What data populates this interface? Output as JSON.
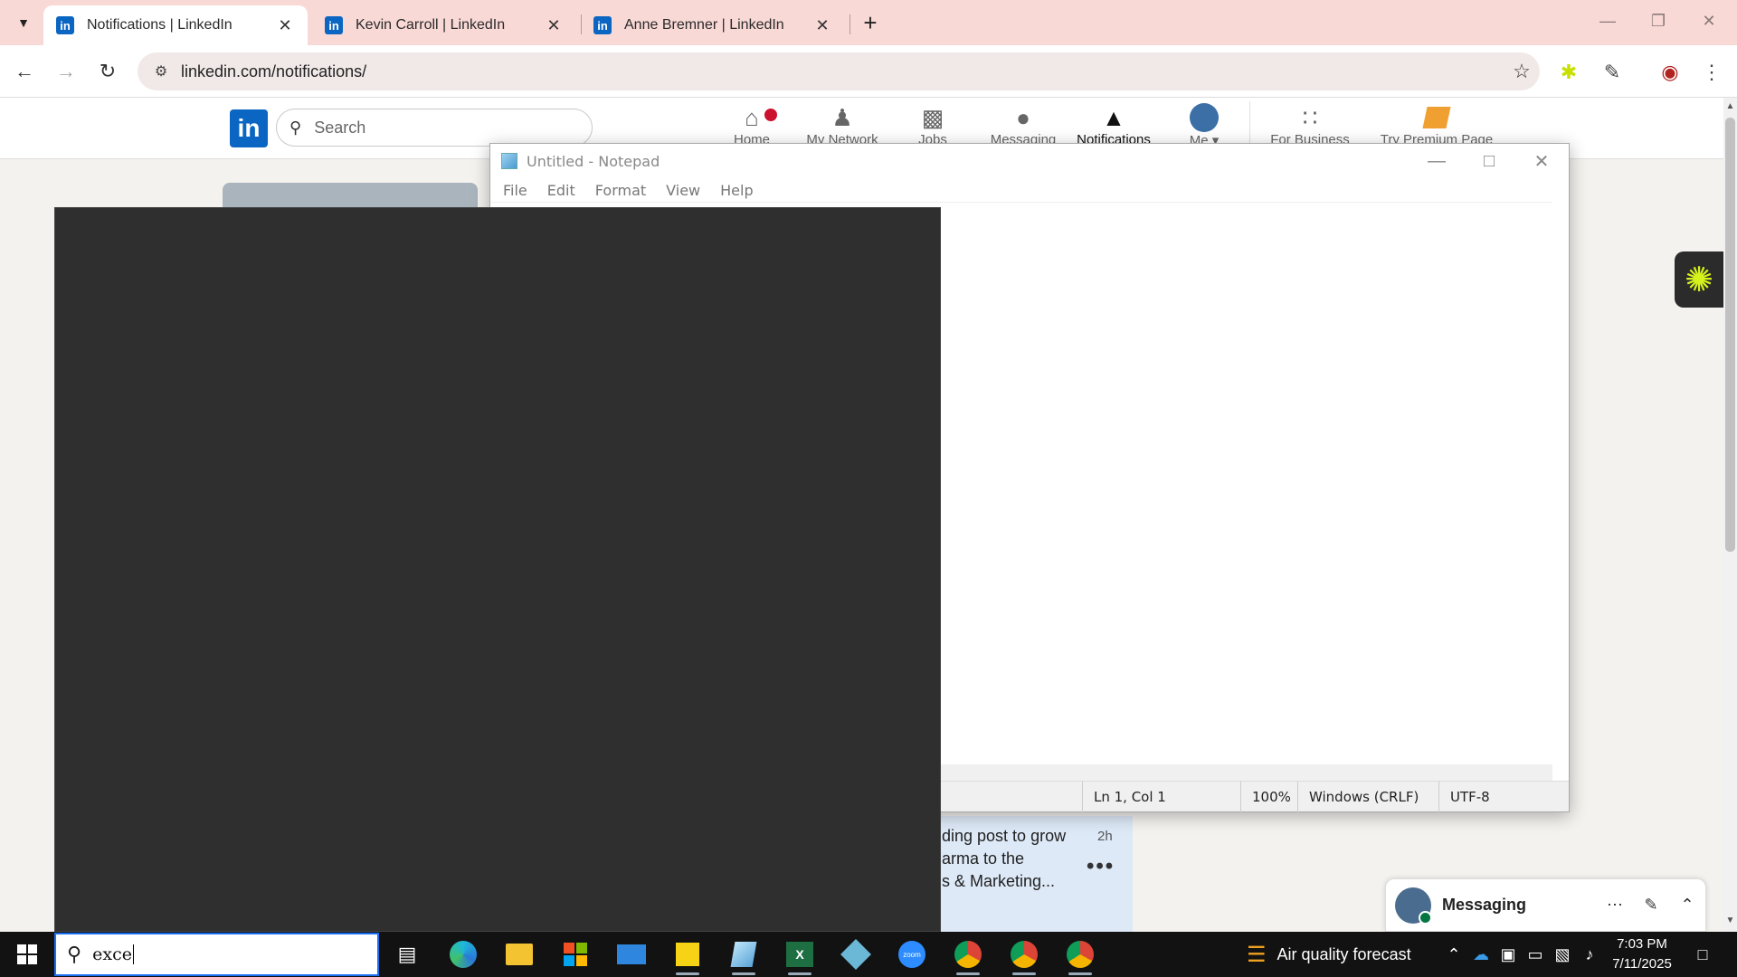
{
  "browser": {
    "tabs": [
      {
        "title": "Notifications | LinkedIn",
        "active": true
      },
      {
        "title": "Kevin Carroll | LinkedIn",
        "active": false
      },
      {
        "title": "Anne Bremner | LinkedIn",
        "active": false
      }
    ],
    "favicon_letters": "in",
    "url": "linkedin.com/notifications/"
  },
  "linkedin": {
    "logo": "in",
    "search_placeholder": "Search",
    "nav": [
      {
        "label": "Home",
        "icon": "home-icon"
      },
      {
        "label": "My Network",
        "icon": "network-icon"
      },
      {
        "label": "Jobs",
        "icon": "briefcase-icon"
      },
      {
        "label": "Messaging",
        "icon": "chat-icon"
      },
      {
        "label": "Notifications",
        "icon": "bell-icon"
      },
      {
        "label": "Me",
        "icon": "avatar"
      },
      {
        "label": "For Business",
        "icon": "grid-icon"
      },
      {
        "label": "Try Premium Page",
        "icon": "premium-icon"
      }
    ],
    "notification": {
      "text_line1": "ding post to grow",
      "text_line2": "arma to the",
      "text_line3": "s & Marketing...",
      "time": "2h"
    },
    "messaging_label": "Messaging"
  },
  "notepad": {
    "title": "Untitled - Notepad",
    "menu": [
      "File",
      "Edit",
      "Format",
      "View",
      "Help"
    ],
    "status": {
      "position": "Ln 1, Col 1",
      "zoom": "100%",
      "line_ending": "Windows (CRLF)",
      "encoding": "UTF-8"
    }
  },
  "taskbar": {
    "search_query": "exce",
    "weather": "Air quality forecast",
    "time": "7:03 PM",
    "date": "7/11/2025",
    "apps": [
      "task-view-icon",
      "edge-icon",
      "file-explorer-icon",
      "store-icon",
      "mail-icon",
      "sticky-notes-icon",
      "notepad-icon",
      "excel-icon",
      "app-icon",
      "zoom-icon",
      "chrome-icon",
      "chrome-icon",
      "chrome-icon"
    ]
  },
  "colors": {
    "linkedin_blue": "#0a66c2",
    "tabbar": "#f9d9d6",
    "notification_badge": "#cb112d",
    "search_focus": "#1b6ff0"
  }
}
